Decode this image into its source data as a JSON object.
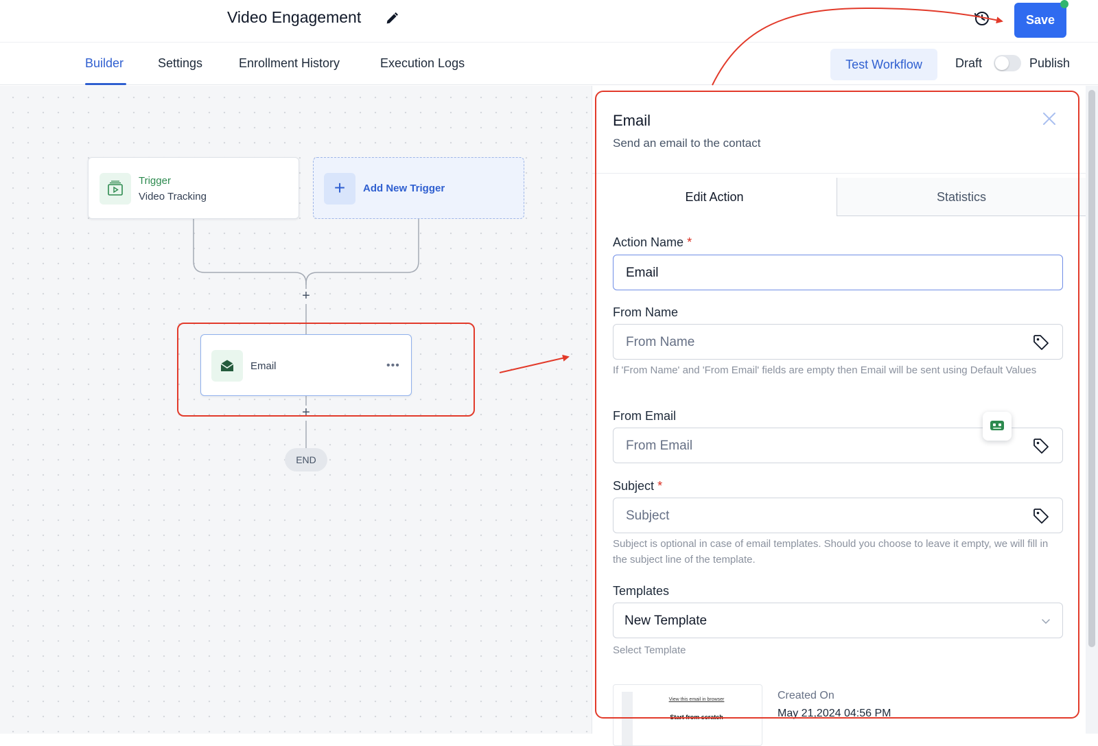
{
  "header": {
    "workflow_title": "Video Engagement",
    "save_label": "Save"
  },
  "nav_tabs": [
    {
      "label": "Builder",
      "active": true
    },
    {
      "label": "Settings"
    },
    {
      "label": "Enrollment History"
    },
    {
      "label": "Execution Logs"
    }
  ],
  "toolbar": {
    "test_label": "Test Workflow",
    "draft_label": "Draft",
    "publish_label": "Publish",
    "publish_on": false
  },
  "canvas": {
    "trigger": {
      "kicker": "Trigger",
      "name": "Video Tracking"
    },
    "add_trigger_label": "Add New Trigger",
    "email_node_label": "Email",
    "end_label": "END"
  },
  "panel": {
    "title": "Email",
    "subtitle": "Send an email to the contact",
    "tabs": [
      {
        "label": "Edit Action"
      },
      {
        "label": "Statistics"
      }
    ],
    "action_name": {
      "label": "Action Name",
      "required": "*",
      "value": "Email"
    },
    "from_name": {
      "label": "From Name",
      "placeholder": "From Name",
      "help": "If 'From Name' and 'From Email' fields are empty then Email will be sent using Default Values"
    },
    "from_email": {
      "label": "From Email",
      "placeholder": "From Email"
    },
    "subject": {
      "label": "Subject",
      "required": "*",
      "placeholder": "Subject",
      "help": "Subject is optional in case of email templates. Should you choose to leave it empty, we will fill in the subject line of the template."
    },
    "templates": {
      "label": "Templates",
      "value": "New Template",
      "help": "Select Template"
    },
    "preview": {
      "link_text": "View this email in browser",
      "heading": "Start from scratch"
    },
    "created_on_label": "Created On",
    "created_on_value": "May 21,2024 04:56 PM"
  },
  "colors": {
    "accent": "#2f6bf0",
    "trigger_green": "#2d8a4f",
    "annotation_red": "#e23a2a"
  },
  "icons": [
    "pencil-icon",
    "history-icon",
    "video-icon",
    "plus-icon",
    "envelope-icon",
    "more-icon",
    "close-icon",
    "tag-icon",
    "chevron-down-icon",
    "chat-bot-icon"
  ]
}
